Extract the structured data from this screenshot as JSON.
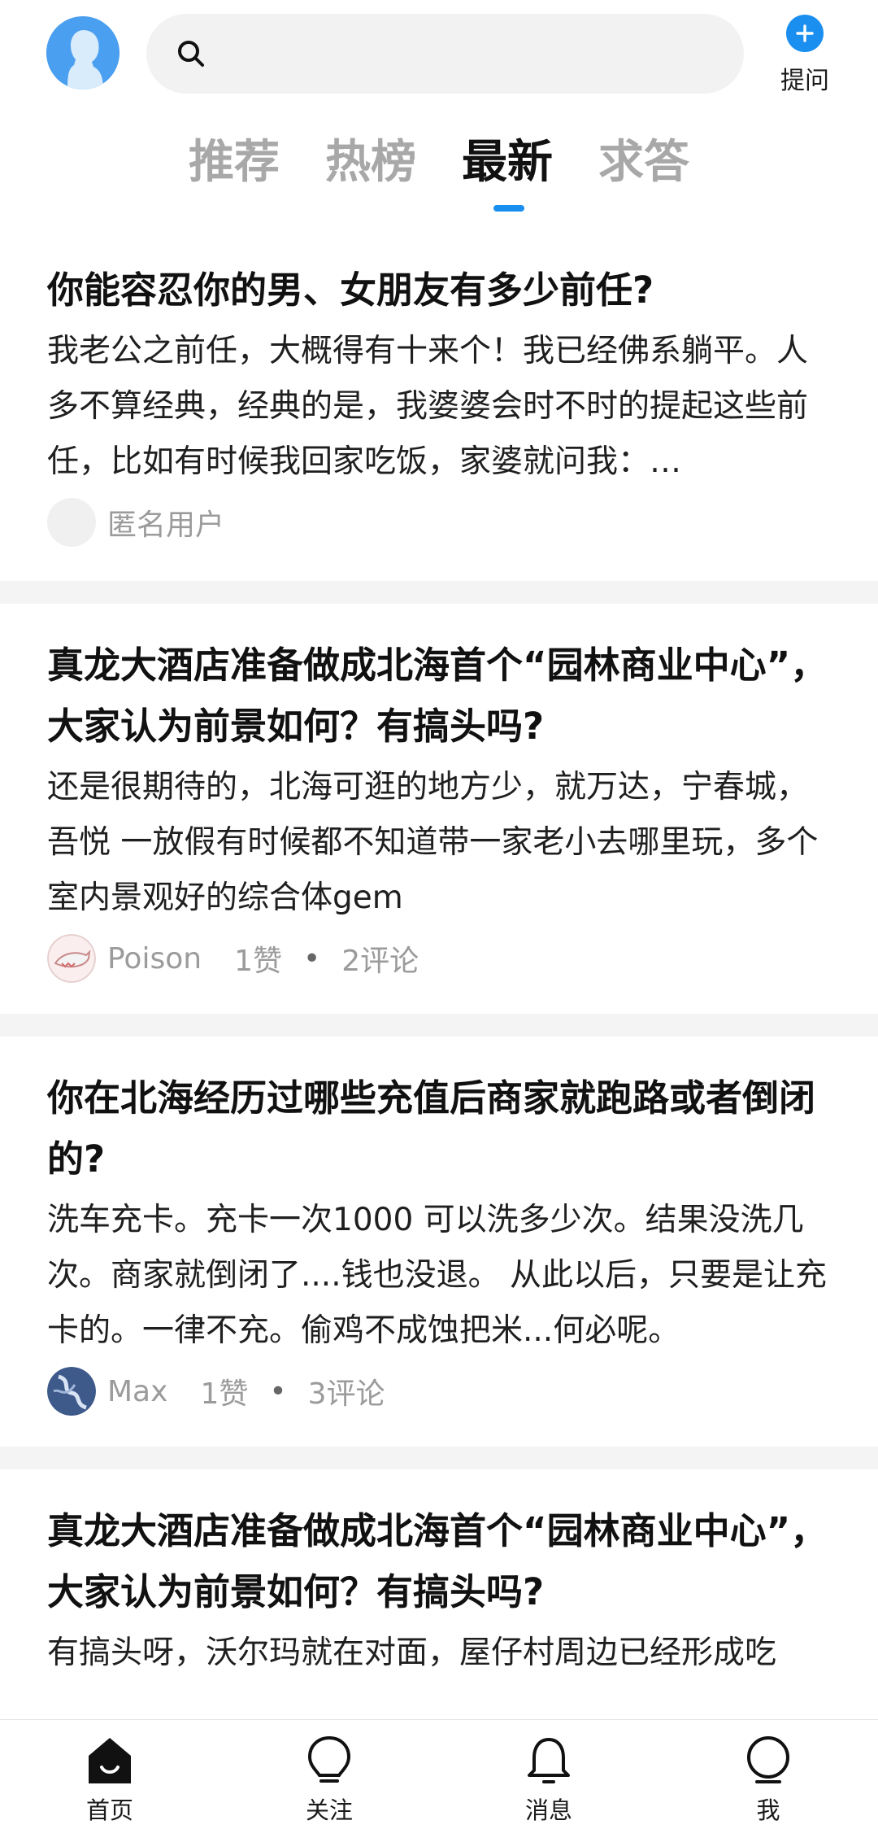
{
  "header": {
    "search": {
      "placeholder": ""
    },
    "ask_label": "提问"
  },
  "tabs": [
    {
      "label": "推荐",
      "active": false
    },
    {
      "label": "热榜",
      "active": false
    },
    {
      "label": "最新",
      "active": true
    },
    {
      "label": "求答",
      "active": false
    }
  ],
  "feed": [
    {
      "title": "你能容忍你的男、女朋友有多少前任?",
      "excerpt": "我老公之前任，大概得有十来个！我已经佛系躺平。人多不算经典，经典的是，我婆婆会时不时的提起这些前任，比如有时候我回家吃饭，家婆就问我：…",
      "author": "匿名用户",
      "likes": "",
      "comments": ""
    },
    {
      "title": "真龙大酒店准备做成北海首个“园林商业中心”，大家认为前景如何？有搞头吗?",
      "excerpt": "还是很期待的，北海可逛的地方少，就万达，宁春城，吾悦 一放假有时候都不知道带一家老小去哪里玩，多个室内景观好的综合体gem",
      "author": "Poison",
      "likes": "1赞",
      "comments": "2评论"
    },
    {
      "title": "你在北海经历过哪些充值后商家就跑路或者倒闭的?",
      "excerpt": "洗车充卡。充卡一次1000 可以洗多少次。结果没洗几次。商家就倒闭了....钱也没退。 从此以后，只要是让充卡的。一律不充。偷鸡不成蚀把米...何必呢。",
      "author": "Max",
      "likes": "1赞",
      "comments": "3评论"
    },
    {
      "title": "真龙大酒店准备做成北海首个“园林商业中心”，大家认为前景如何？有搞头吗?",
      "excerpt": "有搞头呀，沃尔玛就在对面，屋仔村周边已经形成吃",
      "author": "",
      "likes": "",
      "comments": ""
    }
  ],
  "bottom_nav": [
    {
      "label": "首页",
      "icon": "home-icon",
      "active": true
    },
    {
      "label": "关注",
      "icon": "bulb-icon",
      "active": false
    },
    {
      "label": "消息",
      "icon": "bell-icon",
      "active": false
    },
    {
      "label": "我",
      "icon": "profile-icon",
      "active": false
    }
  ],
  "colors": {
    "accent": "#1a8ff0",
    "avatar_bg": "#4a9ff0",
    "search_bg": "#f2f2f2",
    "muted_text": "#9b9b9b",
    "divider": "#f4f4f4"
  }
}
